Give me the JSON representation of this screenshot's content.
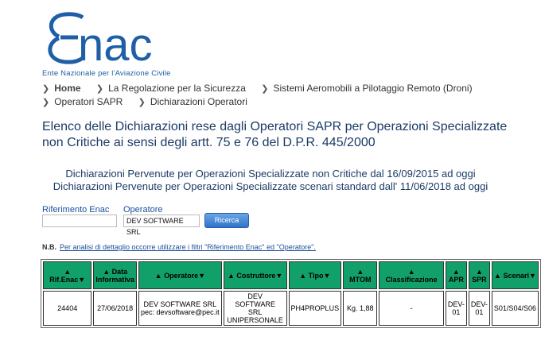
{
  "logo": {
    "text": "ENAC",
    "subtitle": "Ente Nazionale per l'Aviazione Civile",
    "color": "#1f5fa8"
  },
  "breadcrumb": {
    "row1": [
      "Home",
      "La Regolazione per la Sicurezza",
      "Sistemi Aeromobili a Pilotaggio Remoto (Droni)"
    ],
    "row2": [
      "Operatori SAPR",
      "Dichiarazioni Operatori"
    ]
  },
  "page_title": "Elenco delle Dichiarazioni rese dagli Operatori SAPR per Operazioni Specializzate non Critiche ai sensi degli artt. 75 e 76 del D.P.R. 445/2000",
  "subtitles": [
    "Dichiarazioni Pervenute per Operazioni Specializzate non Critiche dal 16/09/2015 ad oggi",
    "Dichiarazioni Pervenute per Operazioni Specializzate scenari standard dall' 11/06/2018 ad oggi"
  ],
  "filters": {
    "ref_label": "Riferimento Enac",
    "ref_value": "",
    "operator_label": "Operatore",
    "operator_value": "DEV SOFTWARE SRL",
    "search_label": "Ricerca"
  },
  "note": {
    "prefix": "N.B.",
    "link": "Per analisi di dettaglio occorre utilizzare i filtri \"Riferimento Enac\" ed \"Operatore\"."
  },
  "table": {
    "header_color": "#12a06a",
    "headers": {
      "rif": "▲ Rif.Enac▼",
      "data1": "▲ Data",
      "data2": "Informativa",
      "operatore": "▲ Operatore▼",
      "costruttore": "▲ Costruttore▼",
      "tipo": "▲ Tipo▼",
      "mtom1": "▲",
      "mtom2": "MTOM",
      "class1": "▲",
      "class2": "Classificazione",
      "apr1": "▲",
      "apr2": "APR",
      "spr1": "▲",
      "spr2": "SPR",
      "scenari": "▲ Scenari▼"
    },
    "row": {
      "rif": "24404",
      "data": "27/06/2018",
      "operatore_name": "DEV SOFTWARE SRL",
      "operatore_pec": "pec: devsoftware@pec.it",
      "costruttore": [
        "DEV",
        "SOFTWARE",
        "SRL",
        "UNIPERSONALE"
      ],
      "tipo": "PH4PROPLUS",
      "mtom": "Kg. 1,88",
      "classificazione": "-",
      "apr": [
        "DEV-",
        "01"
      ],
      "spr": [
        "DEV-",
        "01"
      ],
      "scenari": "S01/S04/S06"
    }
  }
}
